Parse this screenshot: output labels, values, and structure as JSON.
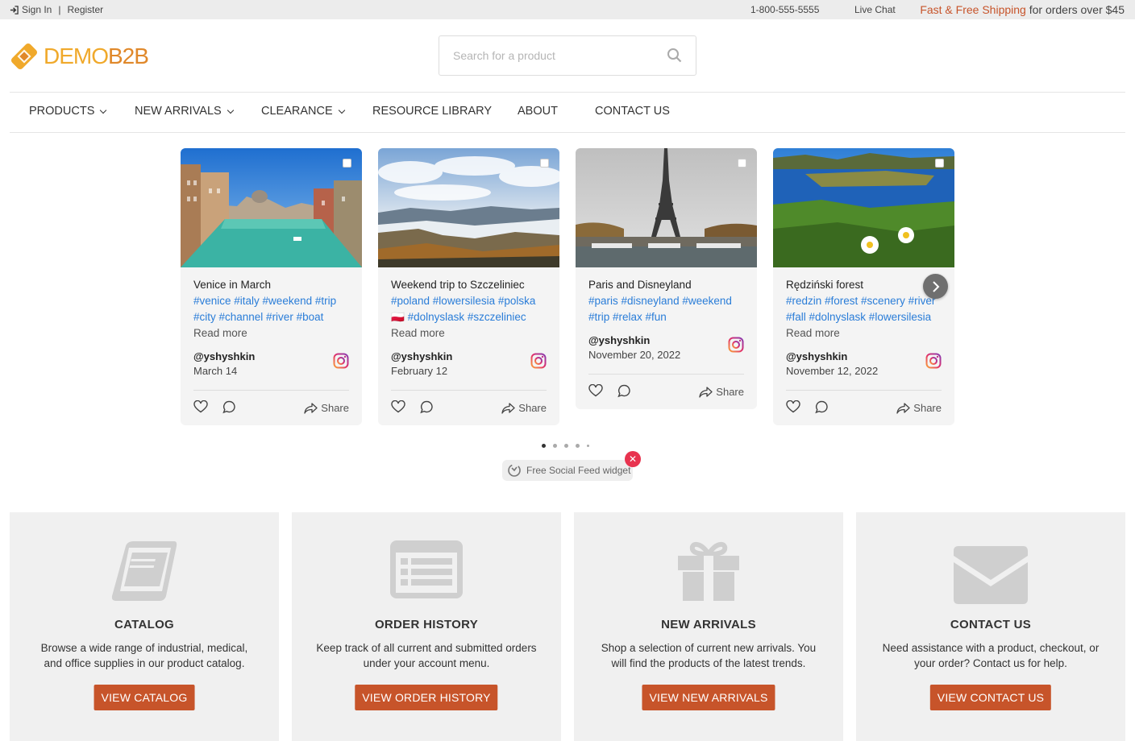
{
  "topbar": {
    "signin": "Sign In",
    "separator": "|",
    "register": "Register",
    "phone": "1-800-555-5555",
    "live_chat": "Live Chat",
    "shipping_highlight": "Fast & Free Shipping",
    "shipping_rest": " for orders over $45"
  },
  "logo": {
    "part1": "DEMO",
    "part2": "B2B"
  },
  "search": {
    "placeholder": "Search for a product"
  },
  "nav": {
    "products": "PRODUCTS",
    "new_arrivals": "NEW ARRIVALS",
    "clearance": "CLEARANCE",
    "resource_library": "RESOURCE LIBRARY",
    "about": "ABOUT",
    "contact_us": "CONTACT US"
  },
  "feed": {
    "cards": [
      {
        "title": "Venice in March",
        "tags_line1": "#venice #italy #weekend #trip",
        "tags_line2": "#city #channel #river #boat",
        "read_more": "Read more",
        "user": "@yshyshkin",
        "date": "March 14",
        "share": "Share"
      },
      {
        "title": "Weekend trip to Szczeliniec",
        "tags_line1": "#poland #lowersilesia #polska",
        "tags_line2": "#dolnyslask #szczeliniec",
        "flag": "🇵🇱",
        "read_more": "Read more",
        "user": "@yshyshkin",
        "date": "February 12",
        "share": "Share"
      },
      {
        "title": "Paris and Disneyland",
        "tags_line1": "#paris #disneyland #weekend",
        "tags_line2": "#trip #relax #fun",
        "user": "@yshyshkin",
        "date": "November 20, 2022",
        "share": "Share"
      },
      {
        "title": "Rędziński forest",
        "tags_line1": "#redzin #forest #scenery #river",
        "tags_line2": "#fall #dolnyslask #lowersilesia",
        "read_more": "Read more",
        "user": "@yshyshkin",
        "date": "November 12, 2022",
        "share": "Share"
      }
    ],
    "widget_label": "Free Social Feed widget",
    "close_glyph": "✕"
  },
  "features": [
    {
      "title": "CATALOG",
      "desc": "Browse a wide range of industrial, medical, and office supplies in our product catalog.",
      "button": "VIEW CATALOG",
      "icon": "book-icon"
    },
    {
      "title": "ORDER HISTORY",
      "desc": "Keep track of all current and submitted orders under your account menu.",
      "button": "VIEW ORDER HISTORY",
      "icon": "list-icon"
    },
    {
      "title": "NEW ARRIVALS",
      "desc": "Shop a selection of current new arrivals. You will find the products of the latest trends.",
      "button": "VIEW NEW ARRIVALS",
      "icon": "gift-icon"
    },
    {
      "title": "CONTACT US",
      "desc": "Need assistance with a product, checkout, or your order? Contact us for help.",
      "button": "VIEW CONTACT US",
      "icon": "envelope-icon"
    }
  ],
  "colors": {
    "accent": "#c7542a",
    "hashtag": "#2a7dd8",
    "logo_yellow": "#f0a92b"
  }
}
